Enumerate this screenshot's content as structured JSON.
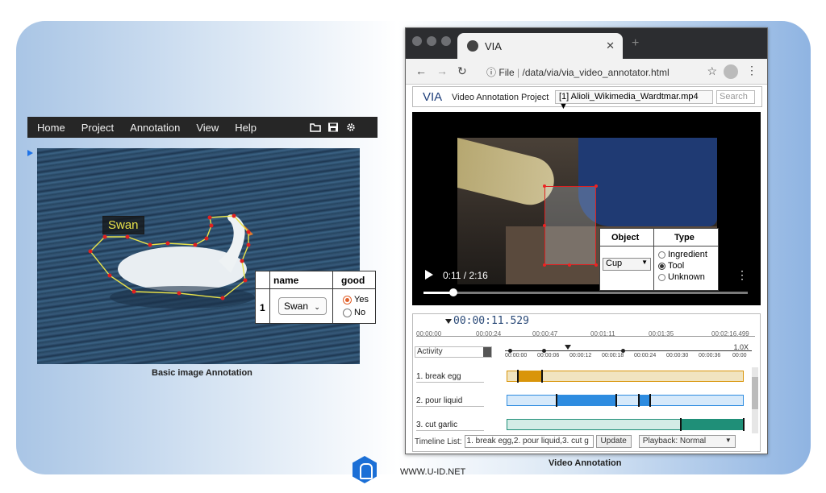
{
  "left_app": {
    "menu": [
      "Home",
      "Project",
      "Annotation",
      "View",
      "Help"
    ],
    "icons": [
      "folder-icon",
      "save-icon",
      "gear-icon"
    ],
    "region_label": "Swan",
    "table": {
      "headers": [
        "name",
        "good"
      ],
      "row_number": "1",
      "name_value": "Swan",
      "options": [
        "Yes",
        "No"
      ],
      "selected": "Yes"
    },
    "caption": "Basic image Annotation"
  },
  "browser": {
    "tab_title": "VIA",
    "url_prefix": "File",
    "url": "/data/via/via_video_annotator.html"
  },
  "via": {
    "logo": "VIA",
    "project_name": "Video Annotation Project",
    "file_select": "[1] Alioli_Wikimedia_Wardtmar.mp4",
    "search_placeholder": "Search",
    "object_table": {
      "headers": [
        "Object",
        "Type"
      ],
      "object_value": "Cup",
      "type_options": [
        "Ingredient",
        "Tool",
        "Unknown"
      ],
      "selected_type": "Tool"
    },
    "player_time": "0:11 / 2:16",
    "current_time": "00:00:11.529",
    "ruler_ticks": [
      "00:00:00",
      "00:00:24",
      "00:00:47",
      "00:01:11",
      "00:01:35",
      "00:02:16.499"
    ],
    "activity_select": "Activity",
    "zoom": "1.0X",
    "zoom_ticks": [
      "00:00:00",
      "00:00:06",
      "00:00:12",
      "00:00:18",
      "00:00:24",
      "00:00:30",
      "00:00:36",
      "00:00"
    ],
    "tracks": [
      "1. break egg",
      "2. pour liquid",
      "3. cut garlic"
    ],
    "timeline_list_label": "Timeline List:",
    "timeline_list_value": "1. break egg,2. pour liquid,3. cut g",
    "update_button": "Update",
    "playback_select": "Playback: Normal"
  },
  "captions": {
    "video": "Video Annotation",
    "site": "WWW.U-ID.NET"
  },
  "colors": {
    "menubar": "#262626",
    "break_egg": "#d9950a",
    "pour_liquid": "#2e8ce0",
    "cut_garlic": "#1f8f78",
    "polygon": "#e8e24a",
    "vertex": "#e02020"
  }
}
